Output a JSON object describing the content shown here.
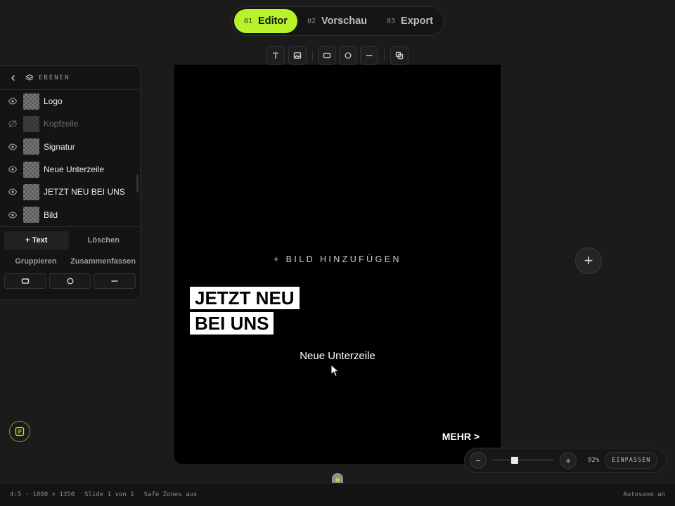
{
  "steps": [
    {
      "num": "01",
      "label": "Editor"
    },
    {
      "num": "02",
      "label": "Vorschau"
    },
    {
      "num": "03",
      "label": "Export"
    }
  ],
  "toolbar": {
    "icons": [
      "text-icon",
      "image-icon",
      "rectangle-icon",
      "circle-icon",
      "line-icon",
      "duplicate-icon"
    ]
  },
  "canvas": {
    "add_image": "+ BILD HINZUFÜGEN",
    "headline": [
      "JETZT NEU",
      "BEI UNS"
    ],
    "subline": "Neue Unterzeile",
    "cta": "MEHR >"
  },
  "layers_panel": {
    "title": "EBENEN",
    "layers": [
      {
        "name": "Logo",
        "visible": true
      },
      {
        "name": "Kopfzeile",
        "visible": false
      },
      {
        "name": "Signatur",
        "visible": true
      },
      {
        "name": "Neue Unterzeile",
        "visible": true
      },
      {
        "name": "JETZT NEU BEI UNS",
        "visible": true
      },
      {
        "name": "Bild",
        "visible": true
      }
    ],
    "add_text": "+ Text",
    "delete": "Löschen",
    "group": "Gruppieren",
    "merge": "Zusammenfassen"
  },
  "fab_label": "+",
  "zoom": {
    "minus": "−",
    "plus": "+",
    "percent": "92%",
    "fit": "EINPASSEN",
    "level": 0.35
  },
  "status_bar": {
    "format": "4:5 · 1080 × 1350",
    "slide": "Slide 1 von 1",
    "safe_zones": "Safe Zones aus",
    "autosave": "Autosave an"
  },
  "colors": {
    "accent": "#b7f22a",
    "canvas": "#000000",
    "background": "#1b1b1b"
  }
}
